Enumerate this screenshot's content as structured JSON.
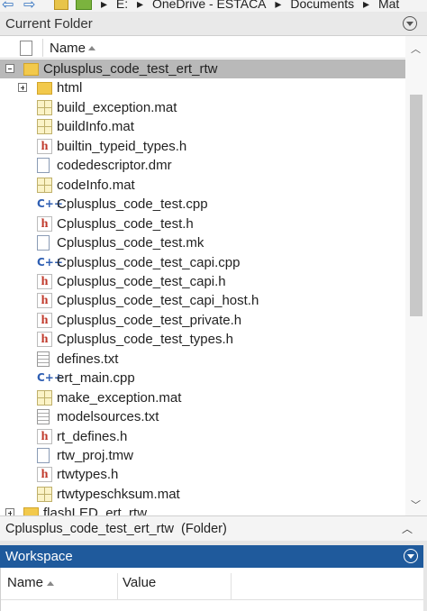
{
  "address_bar": {
    "crumbs": [
      "E:",
      "OneDrive - ESTACA",
      "Documents",
      "Mat"
    ]
  },
  "current_folder": {
    "title": "Current Folder",
    "column_name": "Name",
    "items": [
      {
        "label": "Cplusplus_code_test_ert_rtw",
        "icon": "folder-icon",
        "kind": "folder",
        "level": 0,
        "expander": "minus",
        "selected": true
      },
      {
        "label": "html",
        "icon": "folder-icon",
        "kind": "folder",
        "level": 1,
        "expander": "plus"
      },
      {
        "label": "build_exception.mat",
        "icon": "mat-file-icon",
        "kind": "mat",
        "level": 1
      },
      {
        "label": "buildInfo.mat",
        "icon": "mat-file-icon",
        "kind": "mat",
        "level": 1
      },
      {
        "label": "builtin_typeid_types.h",
        "icon": "h-file-icon",
        "kind": "h",
        "level": 1
      },
      {
        "label": "codedescriptor.dmr",
        "icon": "document-icon",
        "kind": "doc",
        "level": 1
      },
      {
        "label": "codeInfo.mat",
        "icon": "mat-file-icon",
        "kind": "mat",
        "level": 1
      },
      {
        "label": "Cplusplus_code_test.cpp",
        "icon": "cpp-file-icon",
        "kind": "cpp",
        "level": 1
      },
      {
        "label": "Cplusplus_code_test.h",
        "icon": "h-file-icon",
        "kind": "h",
        "level": 1
      },
      {
        "label": "Cplusplus_code_test.mk",
        "icon": "document-icon",
        "kind": "doc",
        "level": 1
      },
      {
        "label": "Cplusplus_code_test_capi.cpp",
        "icon": "cpp-file-icon",
        "kind": "cpp",
        "level": 1
      },
      {
        "label": "Cplusplus_code_test_capi.h",
        "icon": "h-file-icon",
        "kind": "h",
        "level": 1
      },
      {
        "label": "Cplusplus_code_test_capi_host.h",
        "icon": "h-file-icon",
        "kind": "h",
        "level": 1
      },
      {
        "label": "Cplusplus_code_test_private.h",
        "icon": "h-file-icon",
        "kind": "h",
        "level": 1
      },
      {
        "label": "Cplusplus_code_test_types.h",
        "icon": "h-file-icon",
        "kind": "h",
        "level": 1
      },
      {
        "label": "defines.txt",
        "icon": "text-file-icon",
        "kind": "txt",
        "level": 1
      },
      {
        "label": "ert_main.cpp",
        "icon": "cpp-file-icon",
        "kind": "cpp",
        "level": 1
      },
      {
        "label": "make_exception.mat",
        "icon": "mat-file-icon",
        "kind": "mat",
        "level": 1
      },
      {
        "label": "modelsources.txt",
        "icon": "text-file-icon",
        "kind": "txt",
        "level": 1
      },
      {
        "label": "rt_defines.h",
        "icon": "h-file-icon",
        "kind": "h",
        "level": 1
      },
      {
        "label": "rtw_proj.tmw",
        "icon": "document-icon",
        "kind": "doc",
        "level": 1
      },
      {
        "label": "rtwtypes.h",
        "icon": "h-file-icon",
        "kind": "h",
        "level": 1
      },
      {
        "label": "rtwtypeschksum.mat",
        "icon": "mat-file-icon",
        "kind": "mat",
        "level": 1
      },
      {
        "label": "flashLED_ert_rtw",
        "icon": "folder-icon",
        "kind": "folder",
        "level": 0,
        "expander": "plus"
      }
    ]
  },
  "status_bar": {
    "text": "Cplusplus_code_test_ert_rtw  (Folder)"
  },
  "workspace": {
    "title": "Workspace",
    "columns": [
      "Name",
      "Value"
    ]
  },
  "colors": {
    "selection": "#b9b9b9",
    "workspace_header": "#1f5a9c",
    "h_icon": "#c0392b",
    "cpp_icon": "#2f5fb3",
    "folder_icon": "#f2c94c"
  }
}
